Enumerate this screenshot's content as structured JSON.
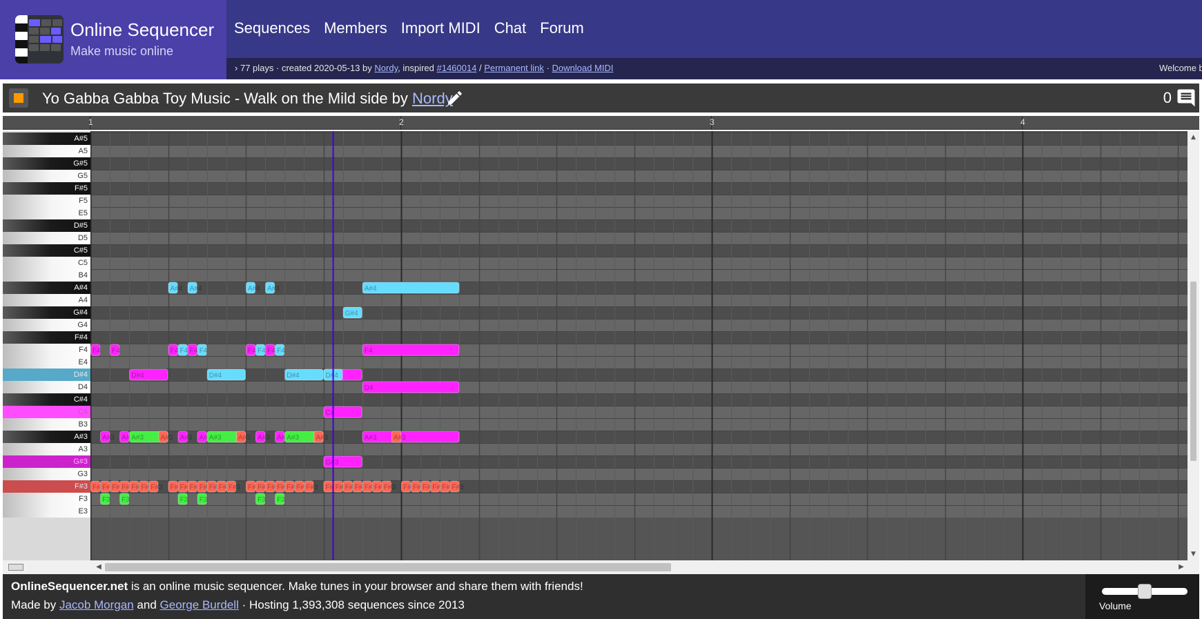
{
  "site": {
    "title": "Online Sequencer",
    "tagline": "Make music online"
  },
  "nav": [
    "Sequences",
    "Members",
    "Import MIDI",
    "Chat",
    "Forum"
  ],
  "info": {
    "arrow": "›",
    "plays_created": "77 plays · created 2020-05-13 by",
    "creator": "Nordy",
    "inspired_label": ", inspired",
    "inspired_link": "#1460014",
    "sep": "/",
    "permanent_link": "Permanent link",
    "dot": "·",
    "download_midi": "Download MIDI",
    "welcome": "Welcome b"
  },
  "song": {
    "title": "Yo Gabba Gabba Toy Music - Walk on the Mild side by",
    "author": "Nordy",
    "chat_count": "0"
  },
  "timeline": {
    "bars": [
      "1",
      "2",
      "3",
      "4"
    ]
  },
  "keys": [
    "A#5",
    "A5",
    "G#5",
    "G5",
    "F#5",
    "F5",
    "E5",
    "D#5",
    "D5",
    "C#5",
    "C5",
    "B4",
    "A#4",
    "A4",
    "G#4",
    "G4",
    "F#4",
    "F4",
    "E4",
    "D#4",
    "D4",
    "C#4",
    "C4",
    "B3",
    "A#3",
    "A3",
    "G#3",
    "G3",
    "F#3",
    "F3",
    "E3"
  ],
  "highlighted_keys": {
    "D#4": "#56a9c8",
    "C4": "#ff4cff",
    "G#3": "#cc22cc",
    "F#3": "#cc4d4d"
  },
  "colors": {
    "magenta": "#ff22ff",
    "cyan": "#66dcff",
    "green": "#44ee44",
    "salmon": "#ff6655",
    "playhead": "#4400dd"
  },
  "playhead_position": 12.5,
  "notes": [
    {
      "label": "F4",
      "note": "F4",
      "start": 0,
      "len": 0.5,
      "color": "magenta"
    },
    {
      "label": "F4",
      "note": "F4",
      "start": 1,
      "len": 0.5,
      "color": "magenta"
    },
    {
      "label": "A#3",
      "note": "A#3",
      "start": 0.5,
      "len": 0.5,
      "color": "magenta"
    },
    {
      "label": "A#3",
      "note": "A#3",
      "start": 1.5,
      "len": 0.5,
      "color": "magenta"
    },
    {
      "label": "D#4",
      "note": "D#4",
      "start": 2,
      "len": 2,
      "color": "magenta"
    },
    {
      "label": "A#3",
      "note": "A#3",
      "start": 2,
      "len": 2,
      "color": "green"
    },
    {
      "label": "A#3",
      "note": "A#3",
      "start": 3.5,
      "len": 0.5,
      "color": "salmon"
    },
    {
      "label": "F3",
      "note": "F3",
      "start": 0.5,
      "len": 0.5,
      "color": "green"
    },
    {
      "label": "F3",
      "note": "F3",
      "start": 1.5,
      "len": 0.5,
      "color": "green"
    },
    {
      "label": "A#4",
      "note": "A#4",
      "start": 4,
      "len": 0.5,
      "color": "cyan"
    },
    {
      "label": "A#4",
      "note": "A#4",
      "start": 5,
      "len": 0.5,
      "color": "cyan"
    },
    {
      "label": "F4",
      "note": "F4",
      "start": 4,
      "len": 0.5,
      "color": "magenta"
    },
    {
      "label": "F4",
      "note": "F4",
      "start": 4.5,
      "len": 0.5,
      "color": "cyan"
    },
    {
      "label": "F4",
      "note": "F4",
      "start": 5,
      "len": 0.5,
      "color": "magenta"
    },
    {
      "label": "F4",
      "note": "F4",
      "start": 5.5,
      "len": 0.5,
      "color": "cyan"
    },
    {
      "label": "A#3",
      "note": "A#3",
      "start": 4.5,
      "len": 0.5,
      "color": "magenta"
    },
    {
      "label": "A#3",
      "note": "A#3",
      "start": 5.5,
      "len": 0.5,
      "color": "magenta"
    },
    {
      "label": "D#4",
      "note": "D#4",
      "start": 6,
      "len": 2,
      "color": "cyan"
    },
    {
      "label": "A#3",
      "note": "A#3",
      "start": 6,
      "len": 2,
      "color": "green"
    },
    {
      "label": "A#3",
      "note": "A#3",
      "start": 7.5,
      "len": 0.5,
      "color": "salmon"
    },
    {
      "label": "F3",
      "note": "F3",
      "start": 4.5,
      "len": 0.5,
      "color": "green"
    },
    {
      "label": "F3",
      "note": "F3",
      "start": 5.5,
      "len": 0.5,
      "color": "green"
    },
    {
      "label": "A#4",
      "note": "A#4",
      "start": 8,
      "len": 0.5,
      "color": "cyan"
    },
    {
      "label": "A#4",
      "note": "A#4",
      "start": 9,
      "len": 0.5,
      "color": "cyan"
    },
    {
      "label": "F4",
      "note": "F4",
      "start": 8,
      "len": 0.5,
      "color": "magenta"
    },
    {
      "label": "F4",
      "note": "F4",
      "start": 8.5,
      "len": 0.5,
      "color": "cyan"
    },
    {
      "label": "F4",
      "note": "F4",
      "start": 9,
      "len": 0.5,
      "color": "magenta"
    },
    {
      "label": "F4",
      "note": "F4",
      "start": 9.5,
      "len": 0.5,
      "color": "cyan"
    },
    {
      "label": "A#3",
      "note": "A#3",
      "start": 8.5,
      "len": 0.5,
      "color": "magenta"
    },
    {
      "label": "A#3",
      "note": "A#3",
      "start": 9.5,
      "len": 0.5,
      "color": "magenta"
    },
    {
      "label": "D#4",
      "note": "D#4",
      "start": 10,
      "len": 2,
      "color": "cyan"
    },
    {
      "label": "A#3",
      "note": "A#3",
      "start": 10,
      "len": 2,
      "color": "green"
    },
    {
      "label": "A#3",
      "note": "A#3",
      "start": 11.5,
      "len": 0.5,
      "color": "salmon"
    },
    {
      "label": "F3",
      "note": "F3",
      "start": 8.5,
      "len": 0.5,
      "color": "green"
    },
    {
      "label": "F3",
      "note": "F3",
      "start": 9.5,
      "len": 0.5,
      "color": "green"
    },
    {
      "label": "D#4",
      "note": "D#4",
      "start": 12,
      "len": 2,
      "color": "magenta"
    },
    {
      "label": "D#4",
      "note": "D#4",
      "start": 12,
      "len": 1,
      "color": "cyan"
    },
    {
      "label": "G#4",
      "note": "G#4",
      "start": 13,
      "len": 1,
      "color": "cyan"
    },
    {
      "label": "C4",
      "note": "C4",
      "start": 12,
      "len": 2,
      "color": "magenta"
    },
    {
      "label": "G#3",
      "note": "G#3",
      "start": 12,
      "len": 2,
      "color": "magenta"
    },
    {
      "label": "A#4",
      "note": "A#4",
      "start": 14,
      "len": 5,
      "color": "cyan"
    },
    {
      "label": "F4",
      "note": "F4",
      "start": 14,
      "len": 5,
      "color": "magenta"
    },
    {
      "label": "D4",
      "note": "D4",
      "start": 14,
      "len": 5,
      "color": "magenta"
    },
    {
      "label": "A#3",
      "note": "A#3",
      "start": 14,
      "len": 5,
      "color": "magenta"
    },
    {
      "label": "A#3",
      "note": "A#3",
      "start": 15.5,
      "len": 0.5,
      "color": "salmon"
    }
  ],
  "fsharp3_hits": [
    0,
    0.5,
    1,
    1.5,
    2,
    2.5,
    3,
    4,
    4.5,
    5,
    5.5,
    6,
    6.5,
    7,
    8,
    8.5,
    9,
    9.5,
    10,
    10.5,
    11,
    12,
    12.5,
    13,
    13.5,
    14,
    14.5,
    15,
    16,
    16.5,
    17,
    17.5,
    18,
    18.5
  ],
  "fsharp3_label": "F#3",
  "footer": {
    "site_bold": "OnlineSequencer.net",
    "line1_rest": " is an online music sequencer. Make tunes in your browser and share them with friends!",
    "made_by": "Made by",
    "author1": "Jacob Morgan",
    "and": "and",
    "author2": "George Burdell",
    "hosting": "· Hosting 1,393,308 sequences since 2013",
    "volume_label": "Volume",
    "volume_level": 0.5
  }
}
